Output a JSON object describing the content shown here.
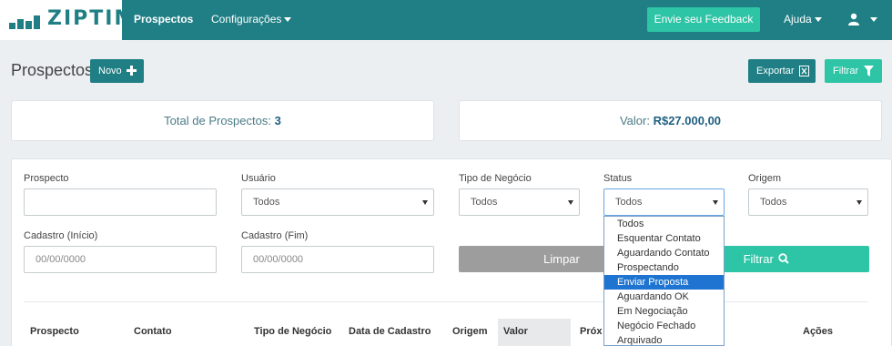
{
  "brand": {
    "name": "ZIPTIME"
  },
  "nav": {
    "prospectos": "Prospectos",
    "configuracoes": "Configurações",
    "feedback": "Envie seu Feedback",
    "ajuda": "Ajuda"
  },
  "colors": {
    "primary": "#1f7f85",
    "accent": "#2ec4a6",
    "selected": "#1e74d0"
  },
  "page": {
    "title": "Prospectos",
    "novo": "Novo",
    "exportar": "Exportar",
    "filtrar": "Filtrar"
  },
  "summary": {
    "total_label": "Total de Prospectos: ",
    "total_value": "3",
    "valor_label": "Valor: ",
    "valor_value": "R$27.000,00"
  },
  "filters": {
    "prospecto_label": "Prospecto",
    "usuario_label": "Usuário",
    "usuario_value": "Todos",
    "tipo_label": "Tipo de Negócio",
    "tipo_value": "Todos",
    "status_label": "Status",
    "status_value": "Todos",
    "origem_label": "Origem",
    "origem_value": "Todos",
    "inicio_label": "Cadastro (Início)",
    "inicio_placeholder": "00/00/0000",
    "fim_label": "Cadastro (Fim)",
    "fim_placeholder": "00/00/0000",
    "limpar": "Limpar",
    "filtrar": "Filtrar"
  },
  "status_options": [
    "Todos",
    "Esquentar Contato",
    "Aguardando Contato",
    "Prospectando",
    "Enviar Proposta",
    "Aguardando OK",
    "Em Negociação",
    "Negócio Fechado",
    "Arquivado"
  ],
  "status_highlighted": "Enviar Proposta",
  "table": {
    "headers": [
      "Prospecto",
      "Contato",
      "Tipo de Negócio",
      "Data de Cadastro",
      "Origem",
      "Valor",
      "Próx",
      "Ações"
    ]
  }
}
